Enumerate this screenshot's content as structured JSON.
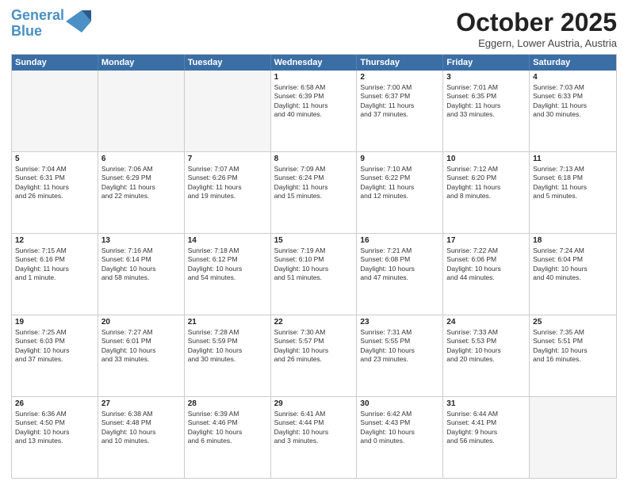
{
  "header": {
    "logo_line1": "General",
    "logo_line2": "Blue",
    "month_title": "October 2025",
    "location": "Eggern, Lower Austria, Austria"
  },
  "day_headers": [
    "Sunday",
    "Monday",
    "Tuesday",
    "Wednesday",
    "Thursday",
    "Friday",
    "Saturday"
  ],
  "weeks": [
    [
      {
        "num": "",
        "text": ""
      },
      {
        "num": "",
        "text": ""
      },
      {
        "num": "",
        "text": ""
      },
      {
        "num": "1",
        "text": "Sunrise: 6:58 AM\nSunset: 6:39 PM\nDaylight: 11 hours\nand 40 minutes."
      },
      {
        "num": "2",
        "text": "Sunrise: 7:00 AM\nSunset: 6:37 PM\nDaylight: 11 hours\nand 37 minutes."
      },
      {
        "num": "3",
        "text": "Sunrise: 7:01 AM\nSunset: 6:35 PM\nDaylight: 11 hours\nand 33 minutes."
      },
      {
        "num": "4",
        "text": "Sunrise: 7:03 AM\nSunset: 6:33 PM\nDaylight: 11 hours\nand 30 minutes."
      }
    ],
    [
      {
        "num": "5",
        "text": "Sunrise: 7:04 AM\nSunset: 6:31 PM\nDaylight: 11 hours\nand 26 minutes."
      },
      {
        "num": "6",
        "text": "Sunrise: 7:06 AM\nSunset: 6:29 PM\nDaylight: 11 hours\nand 22 minutes."
      },
      {
        "num": "7",
        "text": "Sunrise: 7:07 AM\nSunset: 6:26 PM\nDaylight: 11 hours\nand 19 minutes."
      },
      {
        "num": "8",
        "text": "Sunrise: 7:09 AM\nSunset: 6:24 PM\nDaylight: 11 hours\nand 15 minutes."
      },
      {
        "num": "9",
        "text": "Sunrise: 7:10 AM\nSunset: 6:22 PM\nDaylight: 11 hours\nand 12 minutes."
      },
      {
        "num": "10",
        "text": "Sunrise: 7:12 AM\nSunset: 6:20 PM\nDaylight: 11 hours\nand 8 minutes."
      },
      {
        "num": "11",
        "text": "Sunrise: 7:13 AM\nSunset: 6:18 PM\nDaylight: 11 hours\nand 5 minutes."
      }
    ],
    [
      {
        "num": "12",
        "text": "Sunrise: 7:15 AM\nSunset: 6:16 PM\nDaylight: 11 hours\nand 1 minute."
      },
      {
        "num": "13",
        "text": "Sunrise: 7:16 AM\nSunset: 6:14 PM\nDaylight: 10 hours\nand 58 minutes."
      },
      {
        "num": "14",
        "text": "Sunrise: 7:18 AM\nSunset: 6:12 PM\nDaylight: 10 hours\nand 54 minutes."
      },
      {
        "num": "15",
        "text": "Sunrise: 7:19 AM\nSunset: 6:10 PM\nDaylight: 10 hours\nand 51 minutes."
      },
      {
        "num": "16",
        "text": "Sunrise: 7:21 AM\nSunset: 6:08 PM\nDaylight: 10 hours\nand 47 minutes."
      },
      {
        "num": "17",
        "text": "Sunrise: 7:22 AM\nSunset: 6:06 PM\nDaylight: 10 hours\nand 44 minutes."
      },
      {
        "num": "18",
        "text": "Sunrise: 7:24 AM\nSunset: 6:04 PM\nDaylight: 10 hours\nand 40 minutes."
      }
    ],
    [
      {
        "num": "19",
        "text": "Sunrise: 7:25 AM\nSunset: 6:03 PM\nDaylight: 10 hours\nand 37 minutes."
      },
      {
        "num": "20",
        "text": "Sunrise: 7:27 AM\nSunset: 6:01 PM\nDaylight: 10 hours\nand 33 minutes."
      },
      {
        "num": "21",
        "text": "Sunrise: 7:28 AM\nSunset: 5:59 PM\nDaylight: 10 hours\nand 30 minutes."
      },
      {
        "num": "22",
        "text": "Sunrise: 7:30 AM\nSunset: 5:57 PM\nDaylight: 10 hours\nand 26 minutes."
      },
      {
        "num": "23",
        "text": "Sunrise: 7:31 AM\nSunset: 5:55 PM\nDaylight: 10 hours\nand 23 minutes."
      },
      {
        "num": "24",
        "text": "Sunrise: 7:33 AM\nSunset: 5:53 PM\nDaylight: 10 hours\nand 20 minutes."
      },
      {
        "num": "25",
        "text": "Sunrise: 7:35 AM\nSunset: 5:51 PM\nDaylight: 10 hours\nand 16 minutes."
      }
    ],
    [
      {
        "num": "26",
        "text": "Sunrise: 6:36 AM\nSunset: 4:50 PM\nDaylight: 10 hours\nand 13 minutes."
      },
      {
        "num": "27",
        "text": "Sunrise: 6:38 AM\nSunset: 4:48 PM\nDaylight: 10 hours\nand 10 minutes."
      },
      {
        "num": "28",
        "text": "Sunrise: 6:39 AM\nSunset: 4:46 PM\nDaylight: 10 hours\nand 6 minutes."
      },
      {
        "num": "29",
        "text": "Sunrise: 6:41 AM\nSunset: 4:44 PM\nDaylight: 10 hours\nand 3 minutes."
      },
      {
        "num": "30",
        "text": "Sunrise: 6:42 AM\nSunset: 4:43 PM\nDaylight: 10 hours\nand 0 minutes."
      },
      {
        "num": "31",
        "text": "Sunrise: 6:44 AM\nSunset: 4:41 PM\nDaylight: 9 hours\nand 56 minutes."
      },
      {
        "num": "",
        "text": ""
      }
    ]
  ]
}
